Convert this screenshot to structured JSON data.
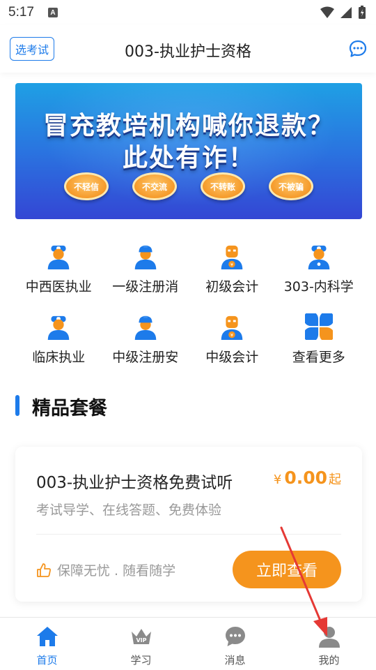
{
  "status_bar": {
    "time": "5:17",
    "notice": "A"
  },
  "header": {
    "exam_switch": "选考试",
    "title": "003-执业护士资格"
  },
  "banner": {
    "line1": "冒充教培机构喊你退款？",
    "line2": "此处有诈！",
    "pills": [
      "不轻信",
      "不交流",
      "不转账",
      "不被骗"
    ]
  },
  "categories": [
    {
      "label": "中西医执业",
      "icon": "doctor-icon"
    },
    {
      "label": "一级注册消",
      "icon": "worker-icon"
    },
    {
      "label": "初级会计",
      "icon": "accountant-icon"
    },
    {
      "label": "303-内科学",
      "icon": "doctor-icon"
    },
    {
      "label": "临床执业",
      "icon": "doctor-icon"
    },
    {
      "label": "中级注册安",
      "icon": "worker-icon"
    },
    {
      "label": "中级会计",
      "icon": "accountant-icon"
    },
    {
      "label": "查看更多",
      "icon": "more-grid-icon"
    }
  ],
  "section": {
    "title": "精品套餐"
  },
  "package": {
    "name": "003-执业护士资格免费试听",
    "currency": "¥",
    "price": "0.00",
    "price_suffix": "起",
    "desc": "考试导学、在线答题、免费体验",
    "guarantee": "保障无忧 . 随看随学",
    "button": "立即查看"
  },
  "tabs": [
    {
      "label": "首页",
      "icon": "home-icon",
      "active": true
    },
    {
      "label": "学习",
      "icon": "vip-crown-icon",
      "active": false
    },
    {
      "label": "消息",
      "icon": "chat-icon",
      "active": false
    },
    {
      "label": "我的",
      "icon": "user-icon",
      "active": false
    }
  ],
  "colors": {
    "accent": "#1d7bea",
    "orange": "#f5941d",
    "annotation": "#e53935"
  }
}
